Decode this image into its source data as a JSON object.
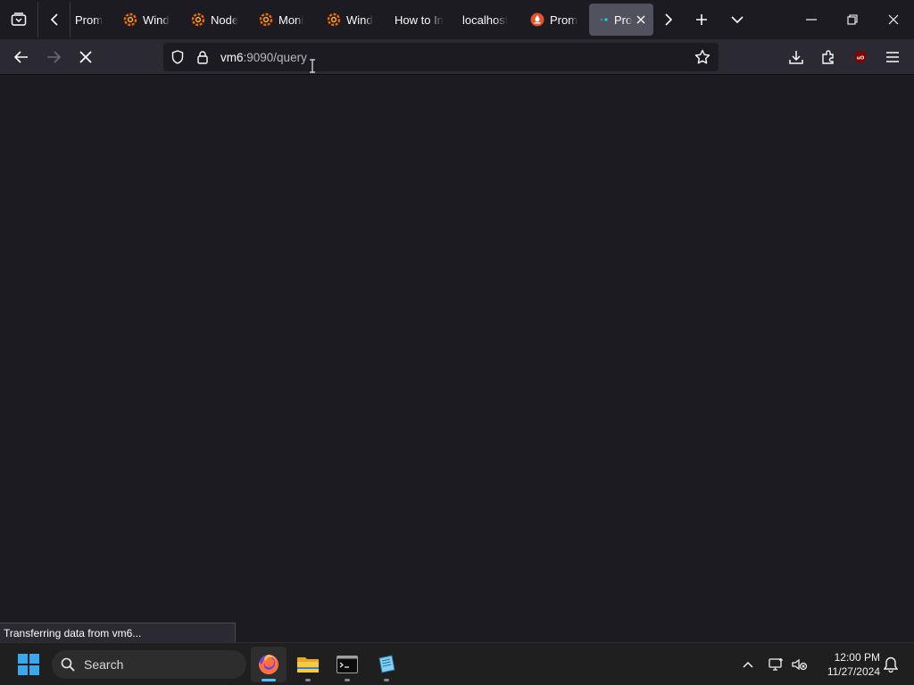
{
  "browser": {
    "tabs": [
      {
        "label": "Prom",
        "icon": "none"
      },
      {
        "label": "Wind",
        "icon": "grafana-icon"
      },
      {
        "label": "Node",
        "icon": "grafana-icon"
      },
      {
        "label": "Moni",
        "icon": "grafana-icon"
      },
      {
        "label": "Wind",
        "icon": "grafana-icon"
      },
      {
        "label": "How to In",
        "icon": "none"
      },
      {
        "label": "localhost",
        "icon": "none"
      },
      {
        "label": "Prom",
        "icon": "prometheus-icon"
      },
      {
        "label": "Pro",
        "icon": "loading-dot-icon",
        "active": true
      }
    ],
    "url": {
      "host": "vm6",
      "path": ":9090/query"
    },
    "status_text": "Transferring data from vm6..."
  },
  "taskbar": {
    "search_label": "Search",
    "apps": [
      "firefox-icon",
      "file-explorer-icon",
      "terminal-icon",
      "notepad-icon"
    ],
    "time": "12:00 PM",
    "date": "11/27/2024"
  },
  "colors": {
    "accent": "#4cc2ff",
    "grafana_orange": "#f46800",
    "prometheus_red": "#e6522c",
    "active_tab": "#52525e"
  }
}
